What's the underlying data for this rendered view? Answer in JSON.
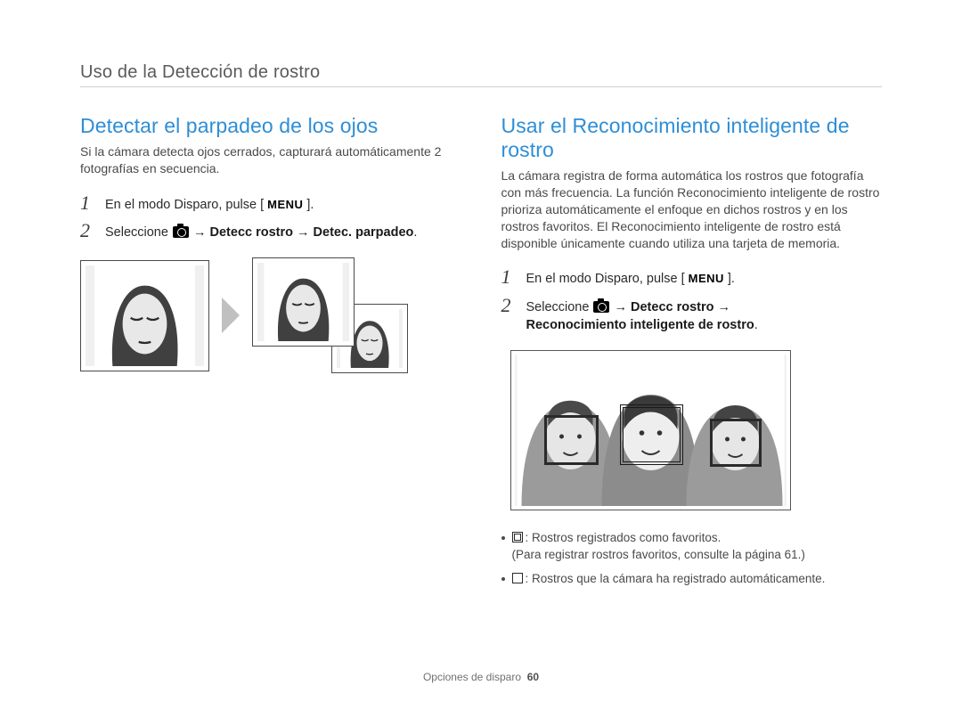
{
  "section_header": "Uso de la Detección de rostro",
  "left": {
    "heading": "Detectar el parpadeo de los ojos",
    "intro": "Si la cámara detecta ojos cerrados, capturará automáticamente 2 fotografías en secuencia.",
    "step1_pre": "En el modo Disparo, pulse [",
    "menu_label": "MENU",
    "step1_post": "].",
    "step2_pre": "Seleccione ",
    "step2_b1": " → Detecc rostro → Detec. parpadeo",
    "step2_post": "."
  },
  "right": {
    "heading": "Usar el Reconocimiento inteligente de rostro",
    "intro": "La cámara registra de forma automática los rostros que fotografía con más frecuencia. La función Reconocimiento inteligente de rostro prioriza automáticamente el enfoque en dichos rostros y en los rostros favoritos. El Reconocimiento inteligente de rostro está disponible únicamente cuando utiliza una tarjeta de memoria.",
    "step1_pre": "En el modo Disparo, pulse [",
    "menu_label": "MENU",
    "step1_post": "].",
    "step2_pre": "Seleccione ",
    "step2_b1": " → Detecc rostro → ",
    "step2_b3": "Reconocimiento inteligente de rostro",
    "step2_post": ".",
    "legend1": ": Rostros registrados como favoritos.",
    "legend1_sub": "(Para registrar rostros favoritos, consulte la página 61.)",
    "legend2": ": Rostros que la cámara ha registrado automáticamente."
  },
  "footer": {
    "label": "Opciones de disparo",
    "page": "60"
  },
  "steps": {
    "one": "1",
    "two": "2"
  }
}
